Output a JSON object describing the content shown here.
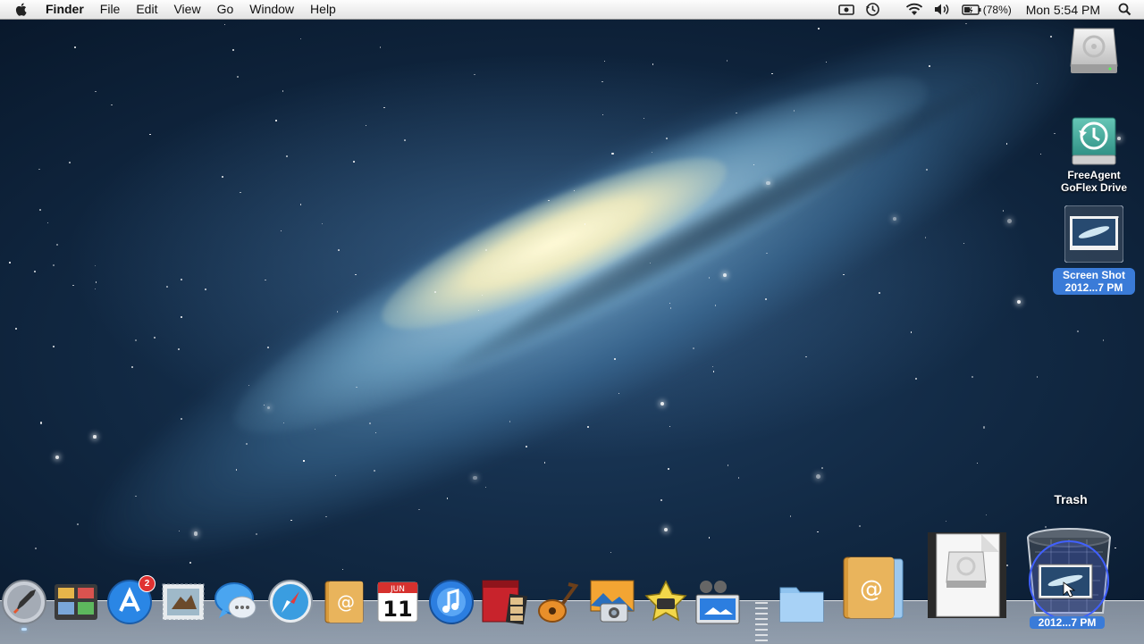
{
  "menubar": {
    "apple_icon": "apple-logo-icon",
    "app_name": "Finder",
    "menus": [
      "File",
      "Edit",
      "View",
      "Go",
      "Window",
      "Help"
    ],
    "status": {
      "icons": [
        "screen-record-icon",
        "time-machine-icon",
        "wifi-icon",
        "volume-icon",
        "battery-icon"
      ],
      "battery_percent": "(78%)",
      "clock": "Mon 5:54 PM",
      "spotlight_icon": "spotlight-search-icon"
    }
  },
  "desktop": {
    "icons": [
      {
        "name": "hard-drive-icon",
        "label": ""
      },
      {
        "name": "time-machine-drive-icon",
        "label_line1": "FreeAgent",
        "label_line2": "GoFlex Drive"
      },
      {
        "name": "screenshot-file-icon",
        "label_line1": "Screen Shot",
        "label_line2": "2012...7 PM"
      }
    ]
  },
  "dock": {
    "apps": [
      {
        "name": "launchpad-icon"
      },
      {
        "name": "mission-control-icon"
      },
      {
        "name": "app-store-icon",
        "badge": "2"
      },
      {
        "name": "mail-icon"
      },
      {
        "name": "messages-icon"
      },
      {
        "name": "safari-icon"
      },
      {
        "name": "contacts-icon"
      },
      {
        "name": "calendar-icon",
        "month": "JUN",
        "day": "11"
      },
      {
        "name": "itunes-icon"
      },
      {
        "name": "photo-booth-icon"
      },
      {
        "name": "garageband-icon"
      },
      {
        "name": "iphoto-icon"
      },
      {
        "name": "imovie-icon"
      },
      {
        "name": "preview-icon"
      }
    ],
    "stacks": [
      {
        "name": "applications-folder-icon"
      },
      {
        "name": "documents-stack-icon"
      },
      {
        "name": "downloads-stack-icon"
      }
    ],
    "trash": {
      "tooltip": "Trash",
      "dragged_file_label": "Screen Shot 2012...7 PM",
      "dragged_label_visible": "2012...7 PM"
    }
  },
  "colors": {
    "menubar_bg": "#efefef",
    "selection_blue": "#3a7bd8",
    "badge_red": "#e03232"
  }
}
